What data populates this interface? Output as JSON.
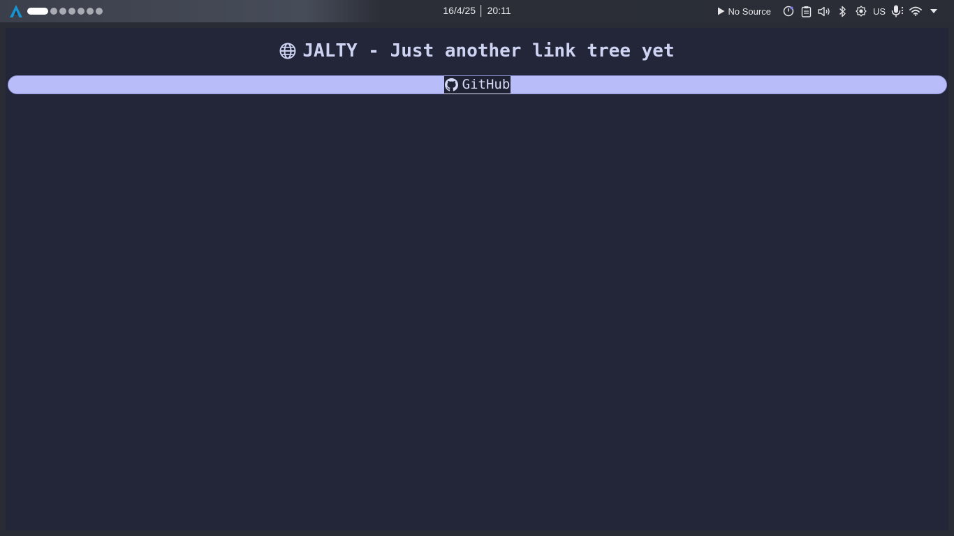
{
  "topbar": {
    "logo_icon": "arch-logo-icon",
    "workspaces": {
      "count": 7,
      "active_index": 0
    },
    "clock": "16/4/25 │ 20:11",
    "media": {
      "icon": "play-icon",
      "label": "No Source"
    },
    "tray_icons": [
      "power-icon",
      "clipboard-icon",
      "volume-icon",
      "bluetooth-icon",
      "brightness-icon"
    ],
    "keyboard_layout": "US",
    "tray_icons_right": [
      "microphone-icon",
      "wifi-icon",
      "dropdown-icon"
    ]
  },
  "page": {
    "title_icon": "globe-icon",
    "title": "JALTY - Just another link tree yet",
    "links": [
      {
        "icon": "github-icon",
        "label": "GitHub"
      }
    ]
  },
  "colors": {
    "page_background": "#232639",
    "link_background": "#b8bcf8",
    "title_text": "#cfd3f2"
  }
}
